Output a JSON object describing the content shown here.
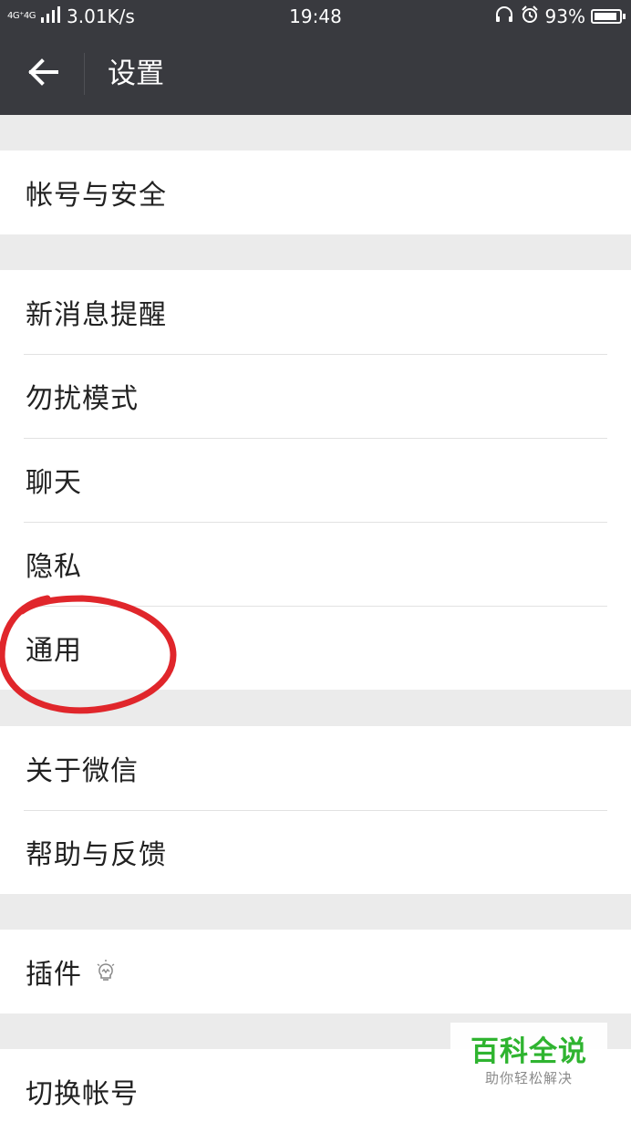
{
  "status_bar": {
    "network_label": "4G⁺4G",
    "speed": "3.01K/s",
    "time": "19:48",
    "battery": "93%",
    "battery_level": 0.93,
    "icons": [
      "headset-icon",
      "alarm-icon"
    ]
  },
  "toolbar": {
    "title": "设置",
    "back_icon": "arrow-left-icon"
  },
  "groups": [
    {
      "items": [
        {
          "label": "帐号与安全"
        }
      ]
    },
    {
      "items": [
        {
          "label": "新消息提醒"
        },
        {
          "label": "勿扰模式"
        },
        {
          "label": "聊天"
        },
        {
          "label": "隐私"
        },
        {
          "label": "通用",
          "annotated": true
        }
      ]
    },
    {
      "items": [
        {
          "label": "关于微信"
        },
        {
          "label": "帮助与反馈"
        }
      ]
    },
    {
      "items": [
        {
          "label": "插件",
          "icon": "lightbulb-icon"
        }
      ]
    },
    {
      "items": [
        {
          "label": "切换帐号"
        }
      ]
    }
  ],
  "annotation": {
    "color": "#e0262b",
    "target": "通用"
  },
  "watermark": {
    "title": "百科全说",
    "subtitle": "助你轻松解决",
    "color": "#2fb430"
  },
  "colors": {
    "toolbar_bg": "#393a3f",
    "page_bg": "#ebebeb",
    "item_bg": "#ffffff",
    "divider": "#e2e2e2"
  }
}
